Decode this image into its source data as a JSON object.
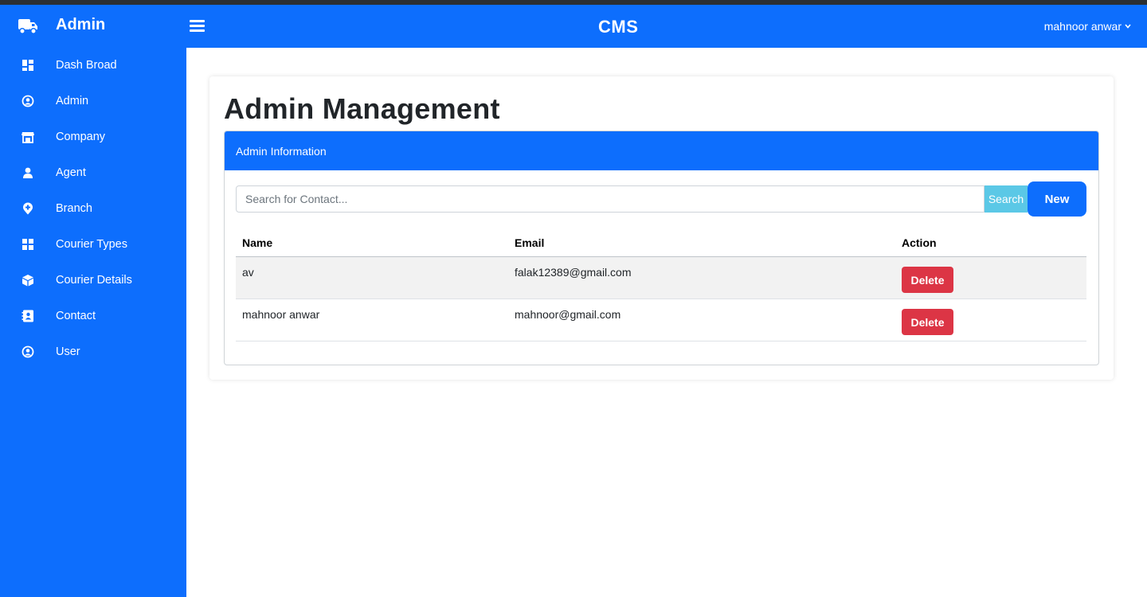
{
  "brand": {
    "name": "Admin",
    "icon": "truck-icon"
  },
  "sidebar": {
    "items": [
      {
        "label": "Dash Broad",
        "icon": "dashboard-icon"
      },
      {
        "label": "Admin",
        "icon": "user-circle-icon"
      },
      {
        "label": "Company",
        "icon": "store-icon"
      },
      {
        "label": "Agent",
        "icon": "person-icon"
      },
      {
        "label": "Branch",
        "icon": "map-pin-plus-icon"
      },
      {
        "label": "Courier Types",
        "icon": "grid-icon"
      },
      {
        "label": "Courier Details",
        "icon": "box-icon"
      },
      {
        "label": "Contact",
        "icon": "contact-card-icon"
      },
      {
        "label": "User",
        "icon": "user-circle-icon"
      }
    ]
  },
  "header": {
    "title": "CMS",
    "user": "mahnoor anwar"
  },
  "main": {
    "title": "Admin Management",
    "panel_title": "Admin Information",
    "search": {
      "placeholder": "Search for Contact...",
      "value": "",
      "button": "Search"
    },
    "new_button": "New",
    "table": {
      "columns": [
        "Name",
        "Email",
        "Action"
      ],
      "rows": [
        {
          "name": "av",
          "email": "falak12389@gmail.com",
          "action": "Delete"
        },
        {
          "name": "mahnoor anwar",
          "email": "mahnoor@gmail.com",
          "action": "Delete"
        }
      ]
    }
  },
  "colors": {
    "primary": "#0d6efd",
    "danger": "#dc3545",
    "info": "#5bc8e6",
    "stripe": "#f2f2f2"
  }
}
